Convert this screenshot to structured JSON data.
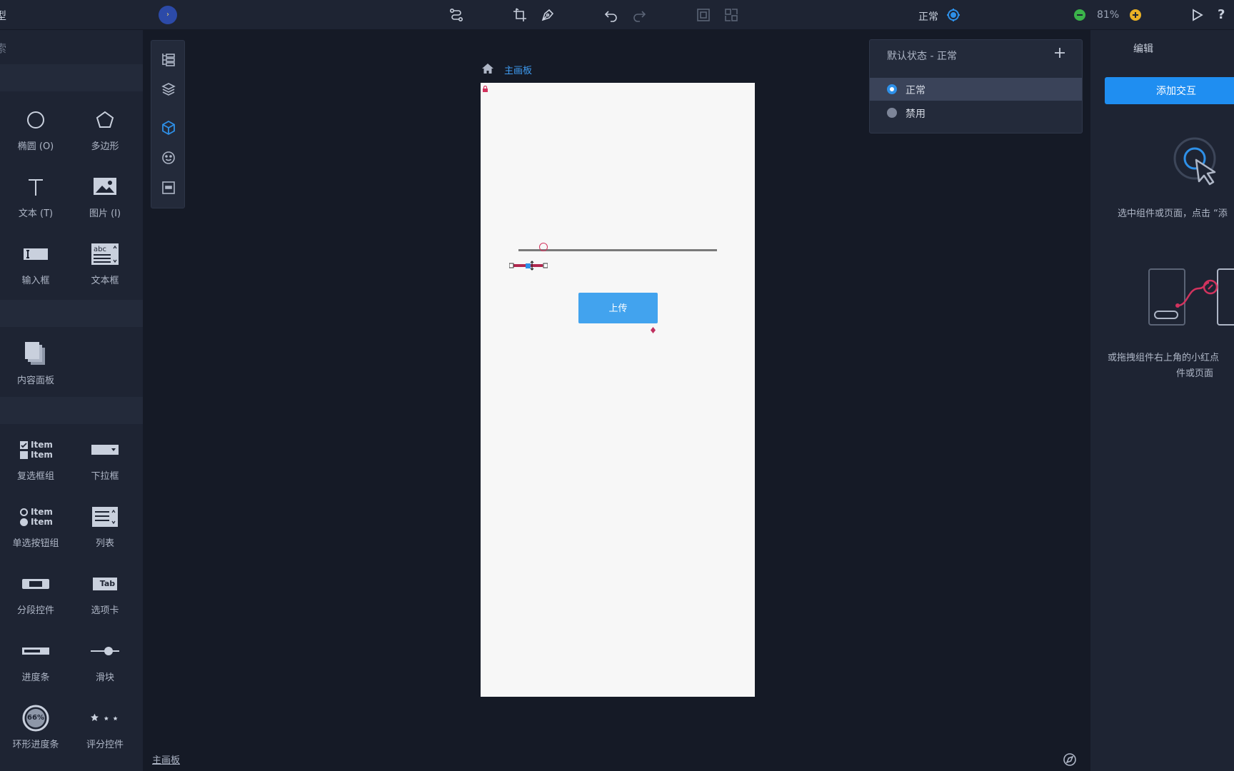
{
  "app": {
    "title_fragment": "型",
    "avatar_glyph": "›"
  },
  "toolbar": {
    "icons": [
      "path-icon",
      "crop-icon",
      "pen-icon",
      "undo-icon",
      "redo-icon",
      "frame-icon",
      "layout-icon"
    ],
    "state_label": "正常",
    "zoom": "81%",
    "accent": "#2e90e8"
  },
  "left_panel": {
    "search_stub": "索",
    "components": [
      {
        "icon": "ellipse-icon",
        "label": "椭圆 (O)"
      },
      {
        "icon": "polygon-icon",
        "label": "多边形"
      },
      {
        "icon": "text-icon",
        "label": "文本 (T)"
      },
      {
        "icon": "image-icon",
        "label": "图片 (I)"
      },
      {
        "icon": "input-icon",
        "label": "输入框"
      },
      {
        "icon": "textarea-icon",
        "label": "文本框"
      },
      {
        "icon": "content-panel-icon",
        "label": "内容面板"
      },
      {
        "icon": "checkbox-group-icon",
        "label": "复选框组",
        "items": [
          "Item",
          "Item"
        ]
      },
      {
        "icon": "dropdown-icon",
        "label": "下拉框"
      },
      {
        "icon": "radio-group-icon",
        "label": "单选按钮组",
        "items": [
          "Item",
          "Item"
        ]
      },
      {
        "icon": "list-icon",
        "label": "列表"
      },
      {
        "icon": "segmented-icon",
        "label": "分段控件"
      },
      {
        "icon": "tabs-icon",
        "label": "选项卡",
        "glyph_text": "Tab"
      },
      {
        "icon": "progress-icon",
        "label": "进度条"
      },
      {
        "icon": "slider-icon",
        "label": "滑块"
      },
      {
        "icon": "ring-progress-icon",
        "label": "环形进度条",
        "glyph_text": "66%"
      },
      {
        "icon": "rating-icon",
        "label": "评分控件"
      }
    ]
  },
  "canvas": {
    "breadcrumb": "主画板",
    "upload_button": "上传",
    "artboard_bg": "#f7f7f7",
    "button_color": "#42a3ee"
  },
  "state_popover": {
    "header": "默认状态 - 正常",
    "states": [
      {
        "label": "正常",
        "selected": true
      },
      {
        "label": "禁用",
        "selected": false
      }
    ]
  },
  "right_panel": {
    "tab": "编辑",
    "add_interaction": "添加交互",
    "hint_select": "选中组件或页面，点击 “添",
    "hint_drag_line1": "或拖拽组件右上角的小红点",
    "hint_drag_line2": "件或页面"
  },
  "bottom": {
    "page_tab": "主画板"
  }
}
